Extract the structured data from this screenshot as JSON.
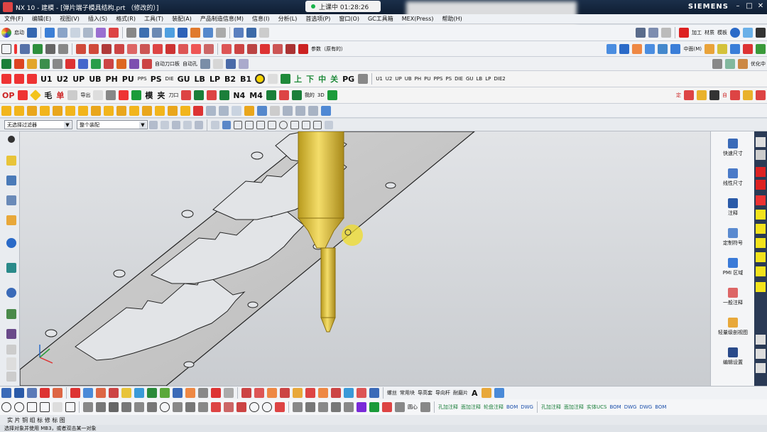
{
  "window": {
    "title": "NX 10 - 建模 - [弹片端子模具结构.prt （修改的）]",
    "brand": "SIEMENS",
    "recording_label": "上课中 01:28:26"
  },
  "menu": [
    "文件(F)",
    "编辑(E)",
    "视图(V)",
    "插入(S)",
    "格式(R)",
    "工具(T)",
    "装配(A)",
    "产品制造信息(M)",
    "信息(I)",
    "分析(L)",
    "首选项(P)",
    "窗口(O)",
    "GC工具箱",
    "MEX(Press)",
    "帮助(H)"
  ],
  "toolbar1": {
    "start_label": "启动",
    "labels": [
      "加工",
      "材质",
      "模板"
    ]
  },
  "toolbar2": {
    "labels": [
      "参数（原有的）",
      "中面(M)"
    ]
  },
  "toolbar3": {
    "labels": [
      "自动刀口板",
      "自动孔",
      "优化中"
    ]
  },
  "toolbar4": {
    "labels": [
      "U1",
      "U2",
      "UP",
      "UB",
      "PH",
      "PU",
      "PPS",
      "PS",
      "DIE",
      "GU",
      "LB",
      "LP",
      "B2",
      "B1",
      "上",
      "下",
      "中",
      "关",
      "PG",
      "U1",
      "U2",
      "UP",
      "UB",
      "PH",
      "PU",
      "PPS",
      "PS",
      "DIE",
      "GU",
      "LB",
      "LP",
      "DIE2"
    ]
  },
  "toolbar5": {
    "labels": [
      "OP",
      "毛",
      "单",
      "导出",
      "模",
      "夹",
      "刀口",
      "N4",
      "M4",
      "我的",
      "3D",
      "定",
      "自"
    ]
  },
  "filter": {
    "selection_filter": "无选择过滤器",
    "assembly_scope": "整个装配"
  },
  "right_panel": [
    "快速尺寸",
    "线性尺寸",
    "注释",
    "定制符号",
    "PMI 区域",
    "一般注释",
    "轻量级剖视图",
    "编辑设置"
  ],
  "bottom_toolbar1": {
    "labels": [
      "螺丝",
      "常用块",
      "导高套",
      "导向杆",
      "耐磨片"
    ]
  },
  "bottom_toolbar2": {
    "labels": [
      "圆心",
      "孔加注释",
      "面加注释",
      "轮盘注释",
      "BOM",
      "DWG",
      "孔加注释",
      "面加注释",
      "实体UCS",
      "BOM",
      "DWG",
      "DWG",
      "BOM"
    ]
  },
  "bottom_tabs": "实 片 铜 组 标 修 标 图",
  "status_text": "选择对象并使用 MB3，或者双击某一对象"
}
